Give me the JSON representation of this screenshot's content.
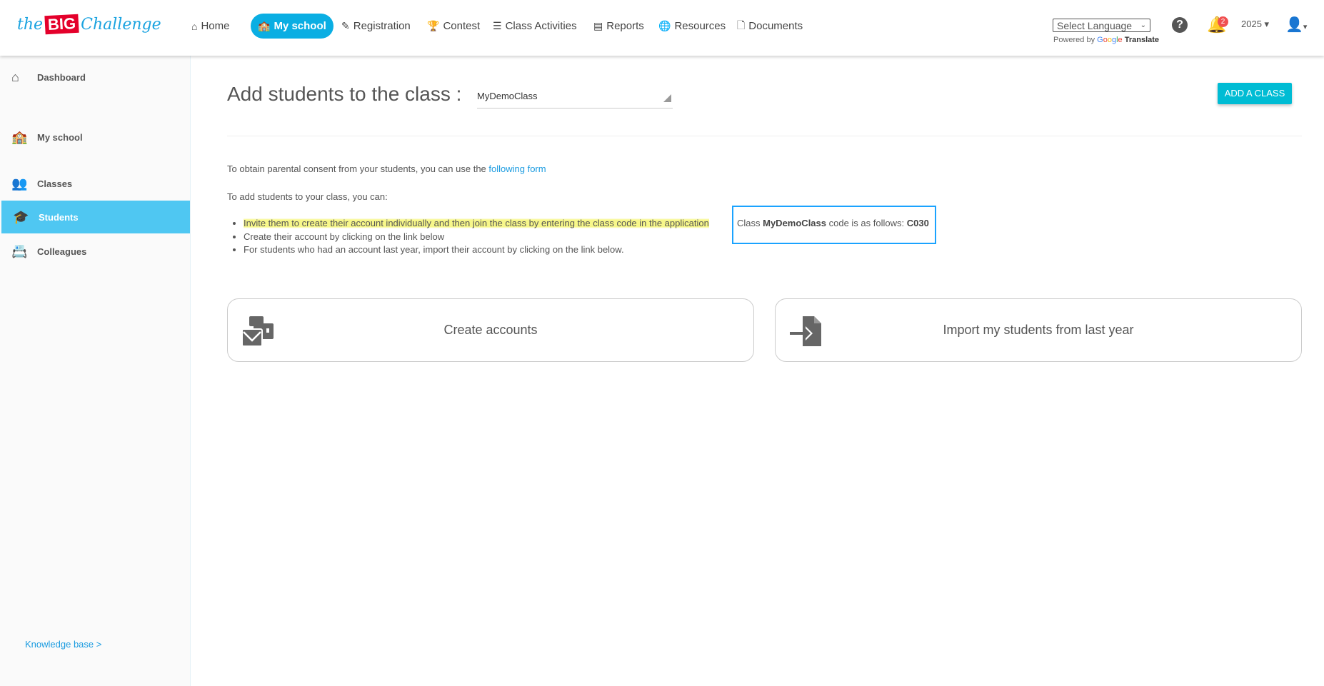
{
  "header": {
    "logo_text": "the BIG Challenge",
    "nav": [
      {
        "label": "Home",
        "icon": "home-icon"
      },
      {
        "label": "My school",
        "icon": "school-icon",
        "active": true
      },
      {
        "label": "Registration",
        "icon": "edit-icon"
      },
      {
        "label": "Contest",
        "icon": "trophy-icon"
      },
      {
        "label": "Class Activities",
        "icon": "list-icon"
      },
      {
        "label": "Reports",
        "icon": "file-icon"
      },
      {
        "label": "Resources",
        "icon": "globe-icon"
      },
      {
        "label": "Documents",
        "icon": "pdf-icon"
      }
    ],
    "language_select": "Select Language",
    "powered_by": "Powered by",
    "google": [
      "G",
      "o",
      "o",
      "g",
      "l",
      "e"
    ],
    "translate": "Translate",
    "notifications": "2",
    "year": "2025"
  },
  "sidebar": {
    "items": [
      {
        "label": "Dashboard",
        "icon": "home-icon"
      },
      {
        "label": "My school",
        "icon": "school-icon"
      },
      {
        "label": "Classes",
        "icon": "users-icon"
      },
      {
        "label": "Students",
        "icon": "graduate-icon",
        "active": true
      },
      {
        "label": "Colleagues",
        "icon": "address-book-icon"
      }
    ],
    "knowledge_base": "Knowledge base >"
  },
  "main": {
    "title": "Add students to the class :",
    "class_select": "MyDemoClass",
    "add_class": "ADD A CLASS",
    "consent_text": "To obtain parental consent from your students, you can use the ",
    "consent_link": "following form",
    "intro": "To add students to your class, you can:",
    "bullets": [
      "Invite them to create their account individually and then join the class by entering the class code in the application",
      "Create their account by clicking on the link below",
      "For students who had an account last year, import their account by clicking on the link below."
    ],
    "code_pre": "Class ",
    "code_class": "MyDemoClass",
    "code_mid": " code is as follows: ",
    "code": "C030",
    "cards": [
      {
        "label": "Create accounts",
        "icon": "create-accounts-icon"
      },
      {
        "label": "Import my students from last year",
        "icon": "file-import-icon"
      }
    ]
  },
  "colors": {
    "accent": "#0aaee3",
    "sidebar_active": "#4fc7f2",
    "button": "#00bcd4",
    "highlight": "#f7f78a",
    "box": "#1aa3ff"
  }
}
